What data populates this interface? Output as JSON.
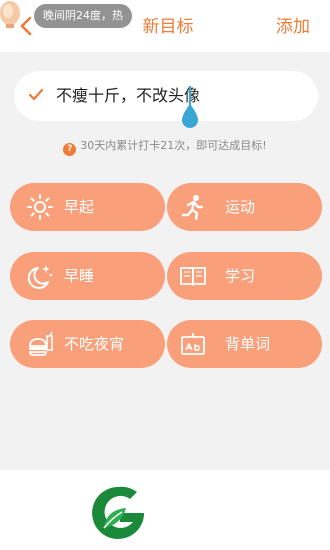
{
  "header": {
    "weather": "晚间阴24度，热",
    "title": "新目标",
    "action": "添加"
  },
  "goal": {
    "text": "不瘦十斤，不改头像"
  },
  "hint": {
    "icon_text": "?",
    "text": "30天内累计打卡21次，即可达成目标!"
  },
  "habits": [
    {
      "label": "早起",
      "icon": "sun-icon"
    },
    {
      "label": "运动",
      "icon": "running-icon"
    },
    {
      "label": "早睡",
      "icon": "moon-stars-icon"
    },
    {
      "label": "学习",
      "icon": "book-icon"
    },
    {
      "label": "不吃夜宵",
      "icon": "burger-drink-icon"
    },
    {
      "label": "背单词",
      "icon": "word-board-icon"
    }
  ],
  "colors": {
    "accent": "#f07a36",
    "habit_bg": "#f9a07b",
    "logo_green": "#1a8a3a"
  }
}
